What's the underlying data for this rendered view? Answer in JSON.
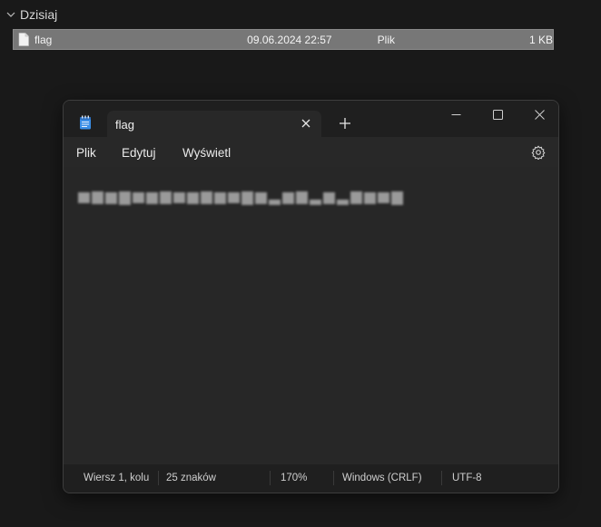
{
  "explorer": {
    "group_title": "Dzisiaj",
    "file": {
      "name": "flag",
      "date": "09.06.2024 22:57",
      "type": "Plik",
      "size": "1 KB"
    }
  },
  "notepad": {
    "tab_title": "flag",
    "menu": {
      "file": "Plik",
      "edit": "Edytuj",
      "view": "Wyświetl"
    },
    "status": {
      "position": "Wiersz 1, kolu",
      "chars": "25 znaków",
      "zoom": "170%",
      "line_endings": "Windows (CRLF)",
      "encoding": "UTF-8"
    }
  },
  "colors": {
    "selection": "#777777",
    "window_bg": "#282828",
    "titlebar_bg": "#1f1f1f",
    "desktop_bg": "#191919"
  }
}
